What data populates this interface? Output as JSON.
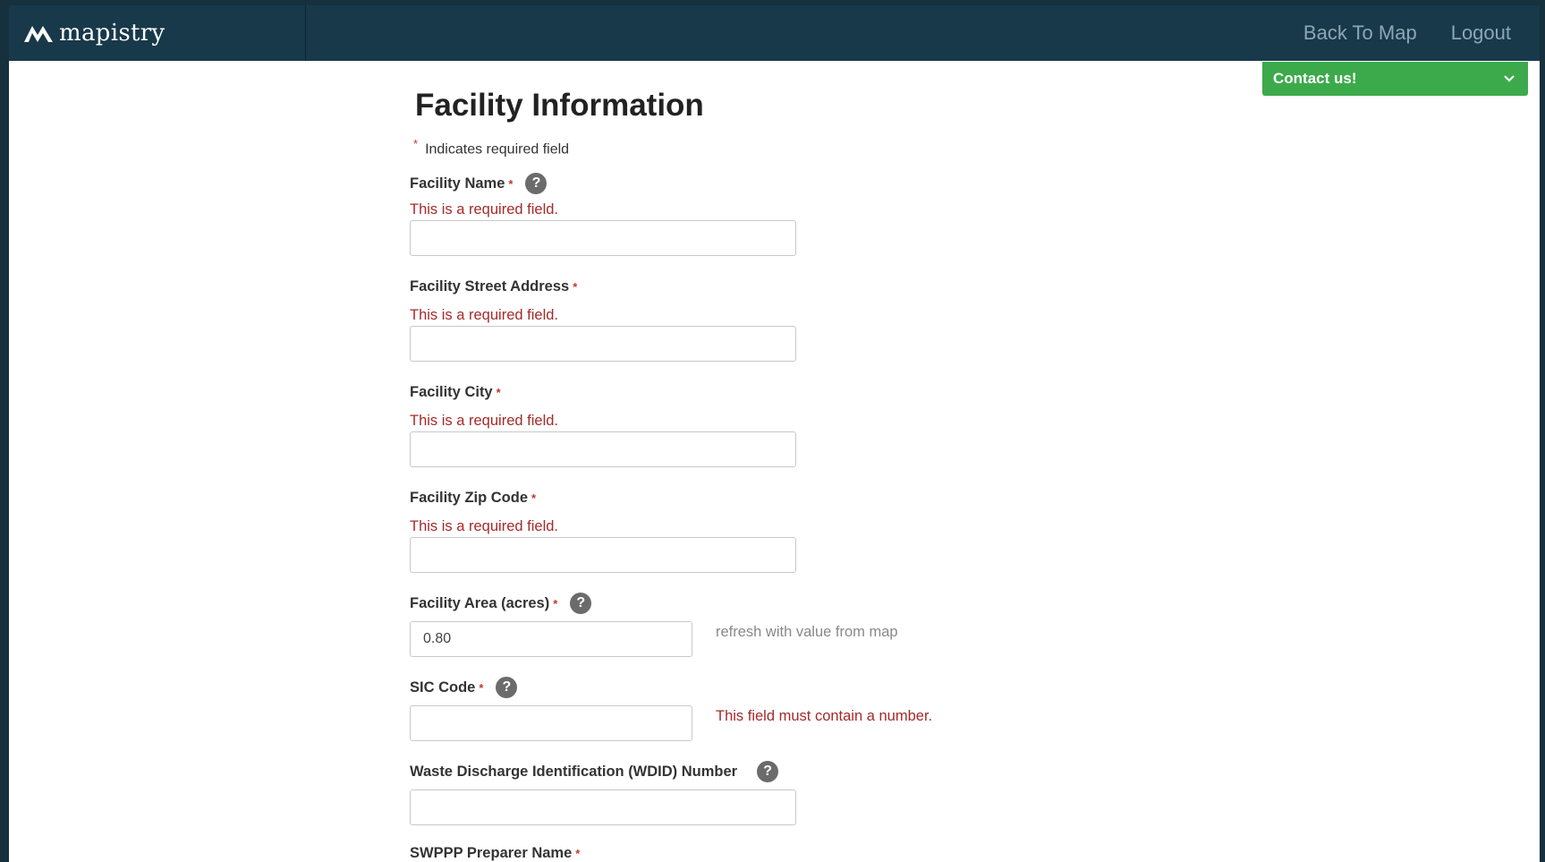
{
  "brand": {
    "name": "mapistry"
  },
  "nav": {
    "back": "Back To Map",
    "logout": "Logout"
  },
  "contact": {
    "label": "Contact us!"
  },
  "form": {
    "title": "Facility Information",
    "required_note": "Indicates required field",
    "required_marker": "*",
    "help_glyph": "?",
    "fields": {
      "name": {
        "label": "Facility Name",
        "error": "This is a required field.",
        "value": ""
      },
      "street": {
        "label": "Facility Street Address",
        "error": "This is a required field.",
        "value": ""
      },
      "city": {
        "label": "Facility City",
        "error": "This is a required field.",
        "value": ""
      },
      "zip": {
        "label": "Facility Zip Code",
        "error": "This is a required field.",
        "value": ""
      },
      "area": {
        "label": "Facility Area (acres)",
        "value": "0.80",
        "refresh": "refresh with value from map"
      },
      "sic": {
        "label": "SIC Code",
        "value": "",
        "error": "This field must contain a number."
      },
      "wdid": {
        "label": "Waste Discharge Identification (WDID) Number",
        "value": ""
      },
      "swppp": {
        "label": "SWPPP Preparer Name"
      }
    }
  },
  "colors": {
    "navbar": "#17394a",
    "accent_green": "#3caa4b",
    "error_red": "#a52a2a",
    "help_icon": "#6b6b6b"
  },
  "icons": {
    "logo": "mountain-logo-icon",
    "help": "question-circle-icon",
    "dropdown": "chevron-down-icon"
  }
}
